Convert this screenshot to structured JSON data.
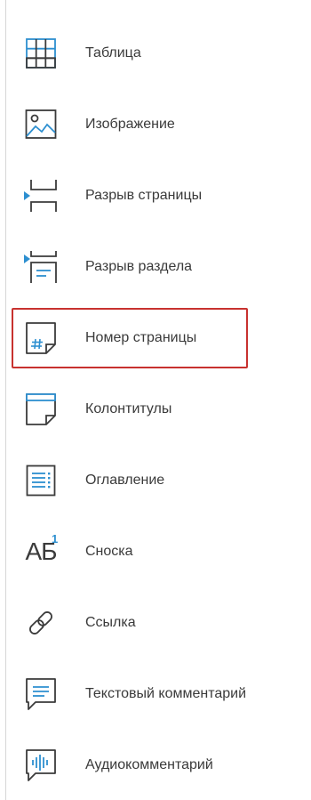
{
  "menu": {
    "items": [
      {
        "label": "Таблица",
        "icon": "table-icon"
      },
      {
        "label": "Изображение",
        "icon": "image-icon"
      },
      {
        "label": "Разрыв страницы",
        "icon": "page-break-icon"
      },
      {
        "label": "Разрыв раздела",
        "icon": "section-break-icon"
      },
      {
        "label": "Номер страницы",
        "icon": "page-number-icon"
      },
      {
        "label": "Колонтитулы",
        "icon": "header-footer-icon"
      },
      {
        "label": "Оглавление",
        "icon": "table-of-contents-icon"
      },
      {
        "label": "Сноска",
        "icon": "footnote-icon"
      },
      {
        "label": "Ссылка",
        "icon": "link-icon"
      },
      {
        "label": "Текстовый комментарий",
        "icon": "text-comment-icon"
      },
      {
        "label": "Аудиокомментарий",
        "icon": "audio-comment-icon"
      }
    ],
    "footnote_glyph": "АБ",
    "footnote_superscript": "1",
    "highlighted_item": "Номер страницы"
  },
  "colors": {
    "icon_dark": "#3b3b3b",
    "icon_accent": "#2d8fd0",
    "highlight_border": "#c8322f"
  }
}
